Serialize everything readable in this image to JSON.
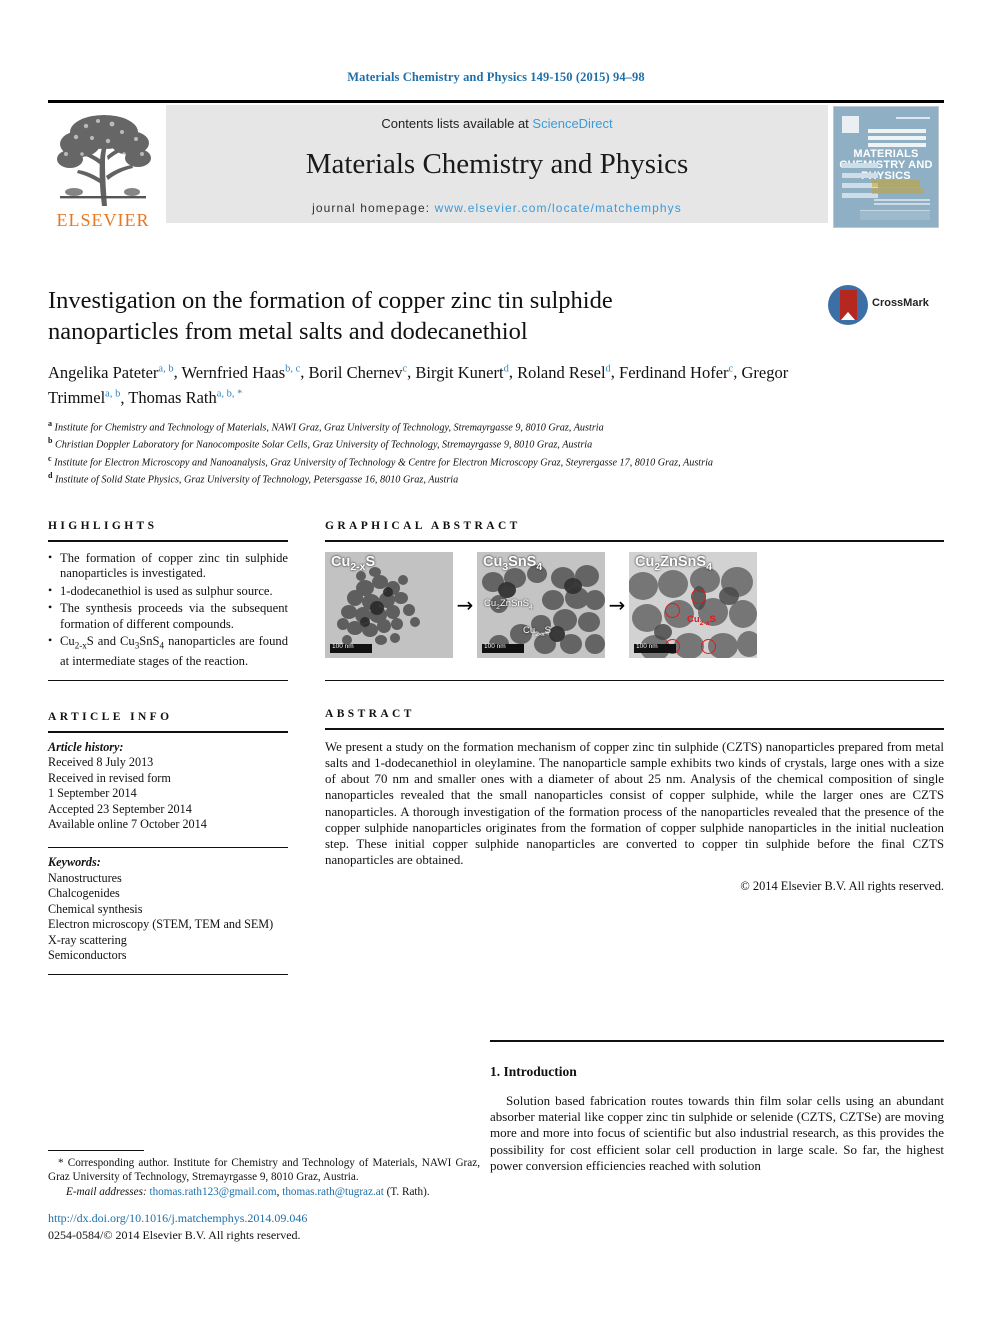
{
  "running_head": "Materials Chemistry and Physics 149-150 (2015) 94–98",
  "masthead": {
    "contents_prefix": "Contents lists available at",
    "sciencedirect": "ScienceDirect",
    "journal_title": "Materials Chemistry and Physics",
    "homepage_prefix": "journal homepage:",
    "homepage_url": "www.elsevier.com/locate/matchemphys",
    "publisher_logo_text": "ELSEVIER",
    "cover": {
      "line1": "MATERIALS",
      "line2": "CHEMISTRY AND",
      "line3": "PHYSICS"
    }
  },
  "article": {
    "title": "Investigation on the formation of copper zinc tin sulphide nanoparticles from metal salts and dodecanethiol",
    "crossmark_label": "CrossMark",
    "authors_line1": "Angelika Pateter",
    "authors": [
      {
        "name": "Angelika Pateter",
        "sup": "a, b"
      },
      {
        "name": "Wernfried Haas",
        "sup": "b, c"
      },
      {
        "name": "Boril Chernev",
        "sup": "c"
      },
      {
        "name": "Birgit Kunert",
        "sup": "d"
      },
      {
        "name": "Roland Resel",
        "sup": "d"
      },
      {
        "name": "Ferdinand Hofer",
        "sup": "c"
      },
      {
        "name": "Gregor Trimmel",
        "sup": "a, b"
      },
      {
        "name": "Thomas Rath",
        "sup": "a, b, *"
      }
    ],
    "affiliations": [
      {
        "marker": "a",
        "text": "Institute for Chemistry and Technology of Materials, NAWI Graz, Graz University of Technology, Stremayrgasse 9, 8010 Graz, Austria"
      },
      {
        "marker": "b",
        "text": "Christian Doppler Laboratory for Nanocomposite Solar Cells, Graz University of Technology, Stremayrgasse 9, 8010 Graz, Austria"
      },
      {
        "marker": "c",
        "text": "Institute for Electron Microscopy and Nanoanalysis, Graz University of Technology & Centre for Electron Microscopy Graz, Steyrergasse 17, 8010 Graz, Austria"
      },
      {
        "marker": "d",
        "text": "Institute of Solid State Physics, Graz University of Technology, Petersgasse 16, 8010 Graz, Austria"
      }
    ]
  },
  "highlights": {
    "heading": "HIGHLIGHTS",
    "items": [
      "The formation of copper zinc tin sulphide nanoparticles is investigated.",
      "1-dodecanethiol is used as sulphur source.",
      "The synthesis proceeds via the subsequent formation of different compounds.",
      "Cu2-xS and Cu3SnS4 nanoparticles are found at intermediate stages of the reaction."
    ]
  },
  "graphical_abstract": {
    "heading": "GRAPHICAL ABSTRACT",
    "panels": [
      {
        "main_label": "Cu2-xS",
        "scalebar": "100 nm",
        "secondary_labels": []
      },
      {
        "main_label": "Cu3SnS4",
        "scalebar": "100 nm",
        "secondary_labels": [
          "Cu2ZnSnS4",
          "Cu2-xS"
        ]
      },
      {
        "main_label": "Cu2ZnSnS4",
        "scalebar": "100 nm",
        "secondary_labels": [
          "Cu2-xS"
        ]
      }
    ]
  },
  "article_info": {
    "heading": "ARTICLE INFO",
    "history_title": "Article history:",
    "history": [
      "Received 8 July 2013",
      "Received in revised form",
      "1 September 2014",
      "Accepted 23 September 2014",
      "Available online 7 October 2014"
    ],
    "keywords_title": "Keywords:",
    "keywords": [
      "Nanostructures",
      "Chalcogenides",
      "Chemical synthesis",
      "Electron microscopy (STEM, TEM and SEM)",
      "X-ray scattering",
      "Semiconductors"
    ]
  },
  "abstract": {
    "heading": "ABSTRACT",
    "body": "We present a study on the formation mechanism of copper zinc tin sulphide (CZTS) nanoparticles prepared from metal salts and 1-dodecanethiol in oleylamine. The nanoparticle sample exhibits two kinds of crystals, large ones with a size of about 70 nm and smaller ones with a diameter of about 25 nm. Analysis of the chemical composition of single nanoparticles revealed that the small nanoparticles consist of copper sulphide, while the larger ones are CZTS nanoparticles. A thorough investigation of the formation process of the nanoparticles revealed that the presence of the copper sulphide nanoparticles originates from the formation of copper sulphide nanoparticles in the initial nucleation step. These initial copper sulphide nanoparticles are converted to copper tin sulphide before the final CZTS nanoparticles are obtained.",
    "copyright": "© 2014 Elsevier B.V. All rights reserved."
  },
  "introduction": {
    "heading": "1. Introduction",
    "paragraph": "Solution based fabrication routes towards thin film solar cells using an abundant absorber material like copper zinc tin sulphide or selenide (CZTS, CZTSe) are moving more and more into focus of scientific but also industrial research, as this provides the possibility for cost efficient solar cell production in large scale. So far, the highest power conversion efficiencies reached with solution"
  },
  "footnote": {
    "corresponding": "* Corresponding author. Institute for Chemistry and Technology of Materials, NAWI Graz, Graz University of Technology, Stremayrgasse 9, 8010 Graz, Austria.",
    "email_label": "E-mail addresses:",
    "email1": "thomas.rath123@gmail.com",
    "email_sep": ", ",
    "email2": "thomas.rath@tugraz.at",
    "email_suffix": " (T. Rath)."
  },
  "footer": {
    "doi": "http://dx.doi.org/10.1016/j.matchemphys.2014.09.046",
    "issn_line": "0254-0584/© 2014 Elsevier B.V. All rights reserved."
  },
  "colors": {
    "link": "#1f6fa8",
    "sciencedirect": "#3c9ad6",
    "elsevier_orange": "#e87722",
    "author_sup": "#2e86c1",
    "crossmark_blue": "#3c6fa5",
    "crossmark_red": "#b5281f",
    "cover_bg": "#8fb0c4",
    "masthead_bg": "#e6e6e6",
    "annotation_red": "#e01b1b"
  }
}
